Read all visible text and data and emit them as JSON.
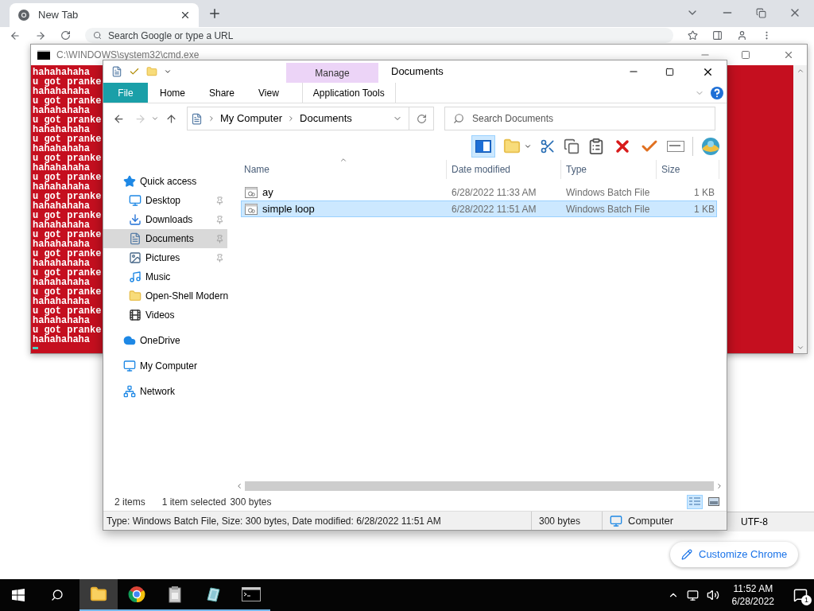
{
  "browser": {
    "tab": {
      "title": "New Tab"
    },
    "omnibox": {
      "placeholder": "Search Google or type a URL"
    },
    "customize_button": {
      "label": "Customize Chrome"
    }
  },
  "notepad_status": {
    "encoding": "UTF-8"
  },
  "console": {
    "title": "C:\\WINDOWS\\system32\\cmd.exe",
    "lines": [
      "hahahahaha",
      "u got pranke",
      "hahahahaha",
      "u got pranke",
      "hahahahaha",
      "u got pranke",
      "hahahahaha",
      "u got pranke",
      "hahahahaha",
      "u got pranke",
      "hahahahaha",
      "u got pranke",
      "hahahahaha",
      "u got pranke",
      "hahahahaha",
      "u got pranke",
      "hahahahaha",
      "u got pranke",
      "hahahahaha",
      "u got pranke",
      "hahahahaha",
      "u got pranke",
      "hahahahaha",
      "u got pranke",
      "hahahahaha",
      "u got pranke",
      "hahahahaha",
      "u got pranke",
      "hahahahaha"
    ]
  },
  "explorer": {
    "title": "Documents",
    "context_group": "Manage",
    "ribbon_tabs": [
      {
        "label": "File",
        "kind": "file"
      },
      {
        "label": "Home",
        "kind": "tab"
      },
      {
        "label": "Share",
        "kind": "tab"
      },
      {
        "label": "View",
        "kind": "tab"
      },
      {
        "label": "Application Tools",
        "kind": "context"
      }
    ],
    "breadcrumbs": [
      "My Computer",
      "Documents"
    ],
    "search": {
      "placeholder": "Search Documents"
    },
    "toolbar": {
      "preview_pane": true
    },
    "navigation": [
      {
        "label": "Quick access",
        "selected": false,
        "children": [
          {
            "label": "Desktop",
            "pinned": true,
            "selected": false
          },
          {
            "label": "Downloads",
            "pinned": true,
            "selected": false
          },
          {
            "label": "Documents",
            "pinned": true,
            "selected": true
          },
          {
            "label": "Pictures",
            "pinned": true,
            "selected": false
          },
          {
            "label": "Music",
            "pinned": false,
            "selected": false
          },
          {
            "label": "Open-Shell Modern",
            "pinned": false,
            "selected": false
          },
          {
            "label": "Videos",
            "pinned": false,
            "selected": false
          }
        ]
      },
      {
        "label": "OneDrive",
        "selected": false
      },
      {
        "label": "My Computer",
        "selected": false
      },
      {
        "label": "Network",
        "selected": false
      }
    ],
    "columns": [
      "Name",
      "Date modified",
      "Type",
      "Size"
    ],
    "files": [
      {
        "name": "ay",
        "date": "6/28/2022 11:33 AM",
        "type": "Windows Batch File",
        "size": "1 KB",
        "selected": false
      },
      {
        "name": "simple loop",
        "date": "6/28/2022 11:51 AM",
        "type": "Windows Batch File",
        "size": "1 KB",
        "selected": true
      }
    ],
    "status": {
      "items": "2 items",
      "selection": "1 item selected",
      "selection_size": "300 bytes"
    },
    "views": [
      {
        "selected": true
      },
      {
        "selected": false
      }
    ],
    "details_bar": {
      "summary": "Type: Windows Batch File, Size: 300 bytes, Date modified: 6/28/2022 11:51 AM",
      "size": "300 bytes",
      "location": "Computer"
    }
  },
  "taskbar": {
    "apps": [
      {
        "selected": true
      },
      {
        "selected": false
      },
      {
        "selected": false
      },
      {
        "selected": false
      },
      {
        "selected": false
      }
    ],
    "time": "11:52 AM",
    "date": "6/28/2022",
    "notifications": "1"
  }
}
